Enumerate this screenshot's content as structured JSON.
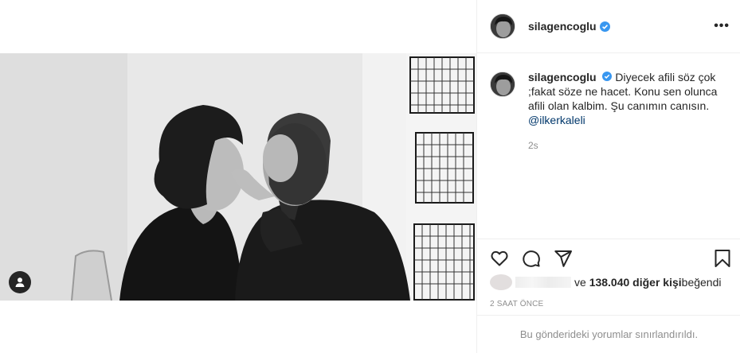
{
  "post": {
    "username": "silagencoglu",
    "verified": true,
    "more_label": "•••",
    "caption": {
      "username": "silagencoglu",
      "text": " Diyecek afili söz çok ;fakat söze ne hacet. Konu sen olunca afili olan kalbim. Şu canımın canısın. ",
      "mention": "@ilkerkaleli",
      "time_ago": "2s"
    },
    "likes": {
      "prefix": "ve",
      "count_text": "138.040 diğer kişi",
      "suffix": " beğendi"
    },
    "date": "2 SAAT ÖNCE",
    "comments_notice": "Bu gönderideki yorumlar sınırlandırıldı."
  },
  "icons": {
    "like": "heart-icon",
    "comment": "comment-icon",
    "share": "share-icon",
    "save": "bookmark-icon",
    "tag": "user-tag-icon",
    "verified": "verified-badge-icon"
  },
  "colors": {
    "verified": "#3897f0",
    "mention": "#00376b",
    "muted": "#8e8e8e",
    "divider": "#efefef"
  }
}
